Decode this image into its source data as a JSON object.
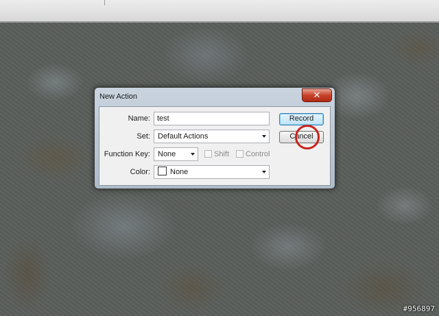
{
  "dialog": {
    "title": "New Action",
    "close_glyph": "✕",
    "fields": {
      "name_label": "Name:",
      "name_value": "test",
      "set_label": "Set:",
      "set_value": "Default Actions",
      "function_key_label": "Function Key:",
      "function_key_value": "None",
      "shift_label": "Shift",
      "control_label": "Control",
      "color_label": "Color:",
      "color_value": "None"
    },
    "buttons": {
      "record": "Record",
      "cancel": "Cancel"
    },
    "shift_checked": false,
    "control_checked": false
  },
  "watermark": "#956897",
  "colors": {
    "annotation_ring": "#c8221c",
    "default_button": "#bfe2f7",
    "close_button": "#c7422a"
  },
  "icons": {
    "close": "close-icon",
    "dropdown": "chevron-down-icon",
    "color_swatch": "color-swatch-icon"
  }
}
